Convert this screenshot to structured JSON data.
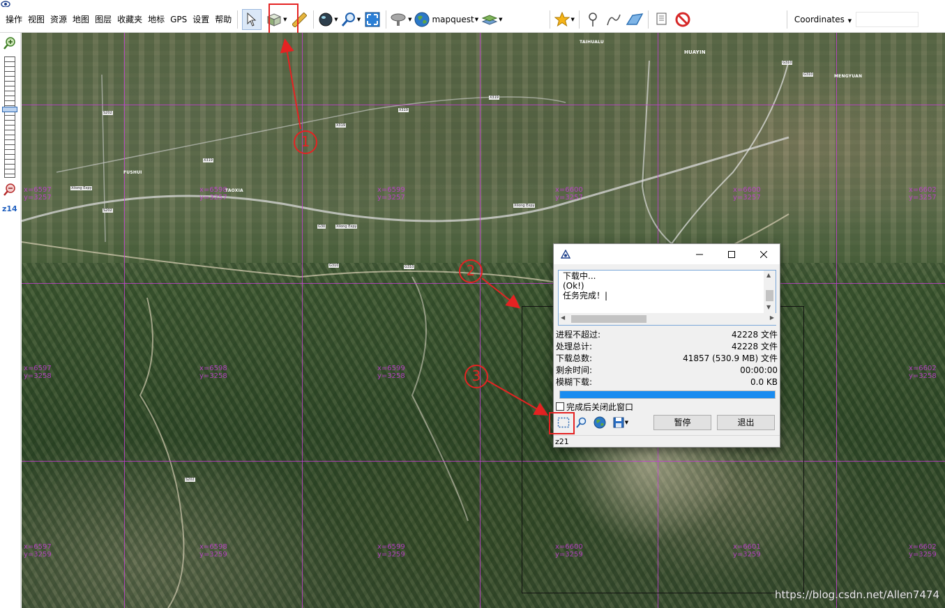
{
  "menu": [
    "操作",
    "视图",
    "资源",
    "地图",
    "图层",
    "收藏夹",
    "地标",
    "GPS",
    "设置",
    "帮助"
  ],
  "toolbar": {
    "source_label": "mapquest",
    "coordinates_label": "Coordinates",
    "coordinates_value": ""
  },
  "zoom": {
    "level_label": "z14"
  },
  "map": {
    "tile_labels": [
      "x=6597",
      "y=3257",
      "x=6598",
      "y=3257",
      "x=6599",
      "y=3257",
      "x=6600",
      "y=3257",
      "x=6602",
      "y=3257",
      "x=6597",
      "y=3258",
      "x=6598",
      "y=3258",
      "x=6599",
      "y=3258",
      "x=6602",
      "y=3258",
      "x=6597",
      "y=3259",
      "x=6598",
      "y=3259",
      "x=6599",
      "y=3259",
      "x=6600",
      "y=3259",
      "x=6601",
      "y=3259",
      "x=6602",
      "y=3259"
    ],
    "places": [
      "TAIHUALU",
      "HUAYIN",
      "MENGYUAN",
      "FUSHUI",
      "TAOXIA"
    ],
    "roads": [
      "X319",
      "X319",
      "X319",
      "G310",
      "G310",
      "Xilong Expy",
      "Xilong Expy",
      "Xilong Expy",
      "S202",
      "S202",
      "G30",
      "G310",
      "S202",
      "G310",
      "X319"
    ],
    "annotations": [
      "1",
      "2",
      "3"
    ],
    "watermark": "https://blog.csdn.net/Allen7474"
  },
  "dialog": {
    "log_lines": [
      "下载中...",
      "(Ok!)",
      "任务完成！|"
    ],
    "stats": [
      {
        "label": "进程不超过:",
        "value": "42228 文件"
      },
      {
        "label": "处理总计:",
        "value": "42228 文件"
      },
      {
        "label": "下载总数:",
        "value": "41857 (530.9 MB) 文件"
      },
      {
        "label": "剩余时间:",
        "value": "00:00:00"
      },
      {
        "label": "模糊下载:",
        "value": "0.0 KB"
      }
    ],
    "progress_fraction": 1.0,
    "close_on_finish_label": "完成后关闭此窗口",
    "pause_label": "暂停",
    "exit_label": "退出",
    "status_text": "z21"
  },
  "colors": {
    "accent_red": "#e52222",
    "grid_magenta": "#c63dd6",
    "progress_blue": "#1a8cf0"
  }
}
